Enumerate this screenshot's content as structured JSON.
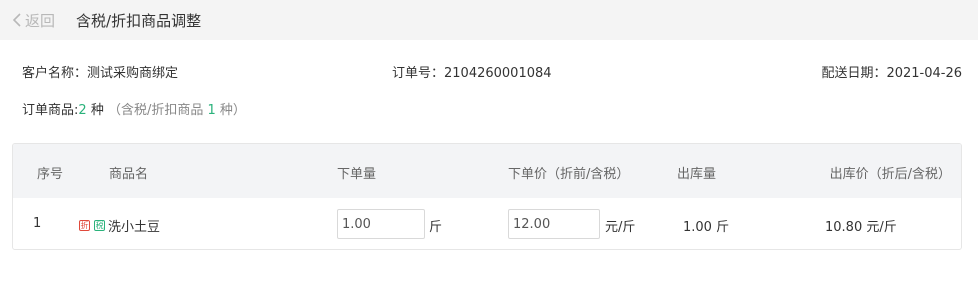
{
  "header": {
    "back_label": "返回",
    "title": "含税/折扣商品调整"
  },
  "order_info": {
    "customer": "客户名称：测试采购商绑定",
    "order_no": "订单号：2104260001084",
    "delivery_date": "配送日期：2021-04-26"
  },
  "summary": {
    "label": "订单商品:",
    "count": "2",
    "unit": "种",
    "note_prefix": "（含税/折扣商品",
    "note_count": "1",
    "note_suffix": "种）"
  },
  "table": {
    "headers": {
      "index": "序号",
      "name": "商品名",
      "order_qty": "下单量",
      "order_price": "下单价（折前/含税）",
      "out_qty": "出库量",
      "out_price": "出库价（折后/含税）"
    },
    "rows": [
      {
        "index": "1",
        "tag_discount": "折",
        "tag_tax": "税",
        "name": "洗小土豆",
        "order_qty": "1.00",
        "order_qty_unit": "斤",
        "order_price": "12.00",
        "order_price_unit": "元/斤",
        "out_qty": "1.00 斤",
        "out_price": "10.80 元/斤"
      }
    ]
  },
  "colors": {
    "accent": "#2ab27b",
    "discount_tag": "#e0493b",
    "header_bg": "#f4f4f4"
  }
}
